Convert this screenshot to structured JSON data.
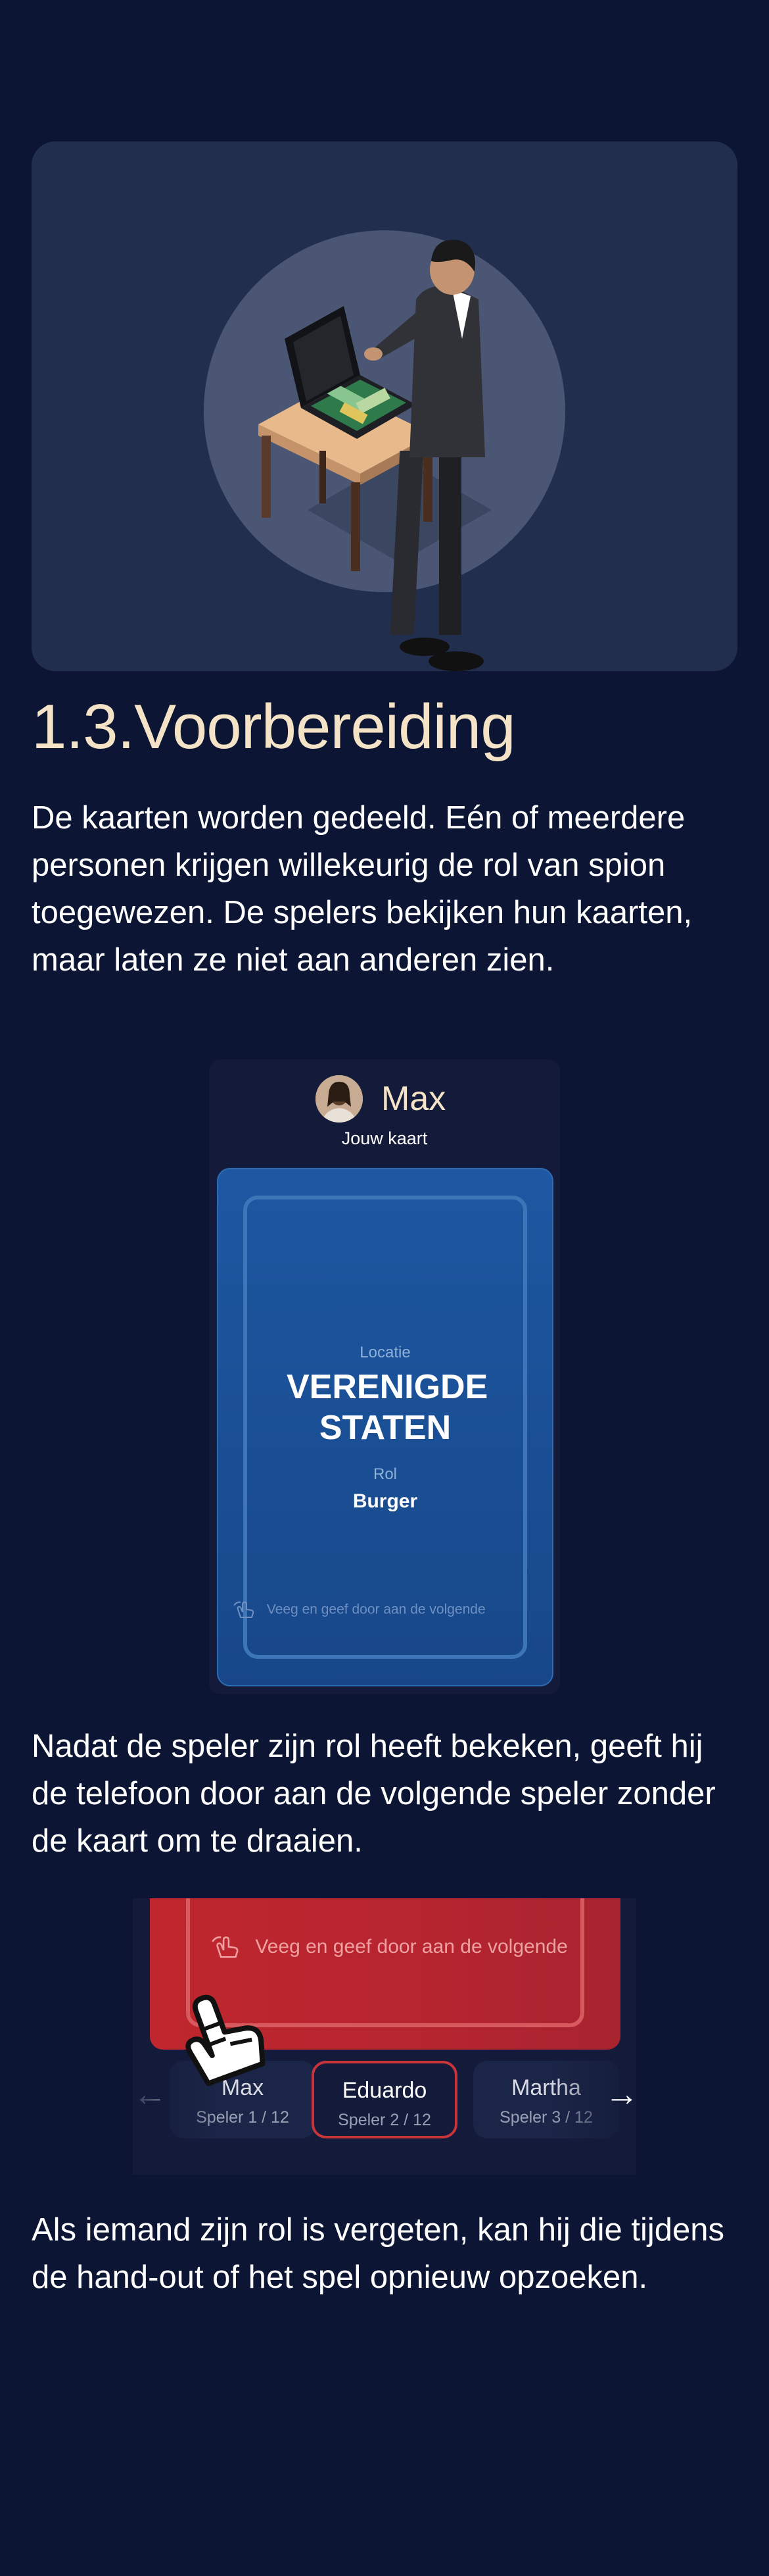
{
  "section": {
    "title": "1.3.Voorbereiding",
    "paragraph1": "De kaarten worden gedeeld. Eén of meerdere personen krijgen willekeurig de rol van spion toegewezen. De spelers bekijken hun kaarten, maar laten ze niet aan anderen zien.",
    "paragraph2": "Nadat de speler zijn rol heeft bekeken, geeft hij de telefoon door aan de volgende speler zonder de kaart om te draaien.",
    "paragraph3": "Als iemand zijn rol is vergeten, kan hij die tijdens de hand-out of het spel opnieuw opzoeken."
  },
  "hero": {
    "illustration": "spy-with-briefcase-illustration"
  },
  "card_mock": {
    "player_name": "Max",
    "subtitle": "Jouw kaart",
    "location_label": "Locatie",
    "location_value": "VERENIGDE STATEN",
    "role_label": "Rol",
    "role_value": "Burger",
    "swipe_hint": "Veeg en geef door aan de volgende"
  },
  "handout_mock": {
    "swipe_hint": "Veeg en geef door aan de volgende",
    "players": [
      {
        "name": "Max",
        "sub": "Speler 1 / 12"
      },
      {
        "name": "Eduardo",
        "sub": "Speler 2 / 12"
      },
      {
        "name": "Martha",
        "sub": "Speler 3 / 12"
      }
    ],
    "prev_arrow": "←",
    "next_arrow": "→"
  },
  "colors": {
    "background": "#0c1634",
    "title": "#f4e3c6",
    "card_blue": "#1e58a2",
    "card_red": "#c0262d"
  }
}
